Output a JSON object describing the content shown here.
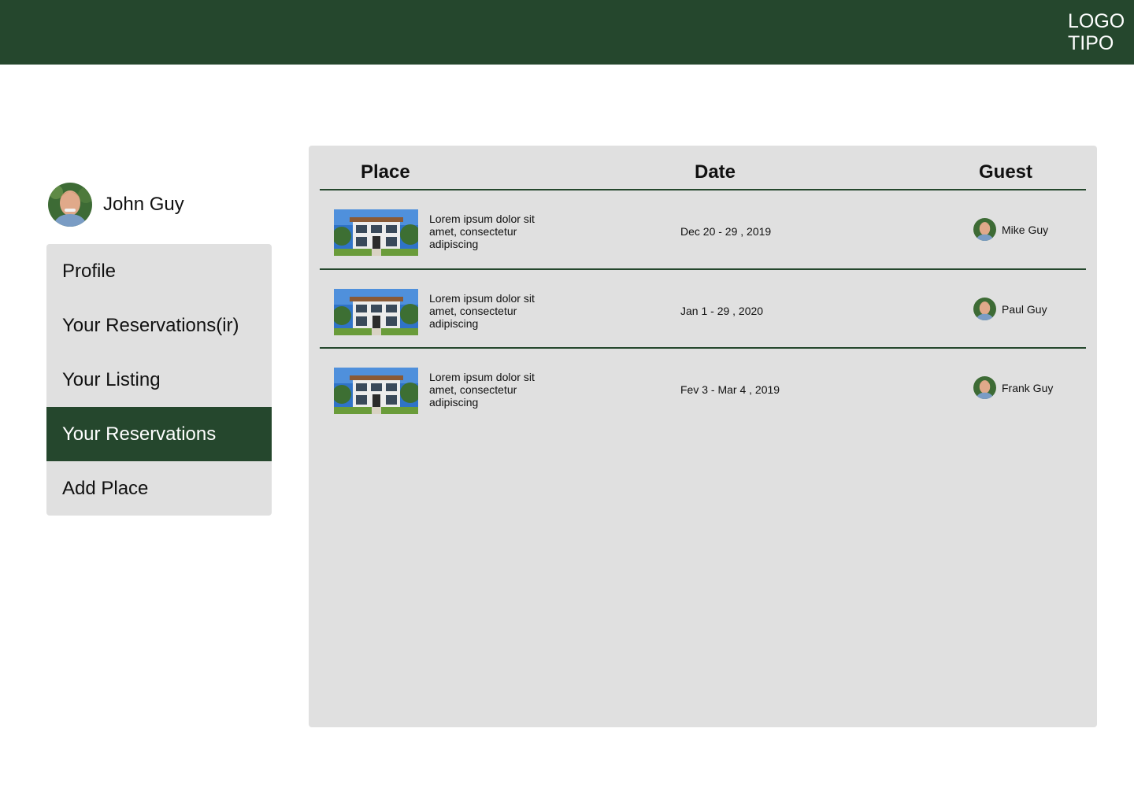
{
  "header": {
    "logo_line1": "LOGO",
    "logo_line2": "TIPO",
    "bg_color": "#25472d"
  },
  "user": {
    "name": "John Guy"
  },
  "menu": {
    "items": [
      {
        "label": "Profile"
      },
      {
        "label": "Your Reservations(ir)"
      },
      {
        "label": "Your Listing"
      },
      {
        "label": "Your Reservations",
        "active": true
      },
      {
        "label": "Add Place"
      }
    ]
  },
  "table": {
    "headers": {
      "place": "Place",
      "date": "Date",
      "guest": "Guest"
    },
    "rows": [
      {
        "place": "Lorem ipsum dolor sit amet, consectetur adipiscing",
        "date": "Dec 20 - 29 , 2019",
        "guest": "Mike Guy"
      },
      {
        "place": "Lorem ipsum dolor sit amet, consectetur adipiscing",
        "date": "Jan 1 - 29 , 2020",
        "guest": "Paul Guy"
      },
      {
        "place": "Lorem ipsum dolor sit amet, consectetur adipiscing",
        "date": "Fev 3 - Mar 4 , 2019",
        "guest": "Frank Guy"
      }
    ]
  },
  "colors": {
    "accent": "#25472d",
    "panel": "#e0e0e0"
  }
}
